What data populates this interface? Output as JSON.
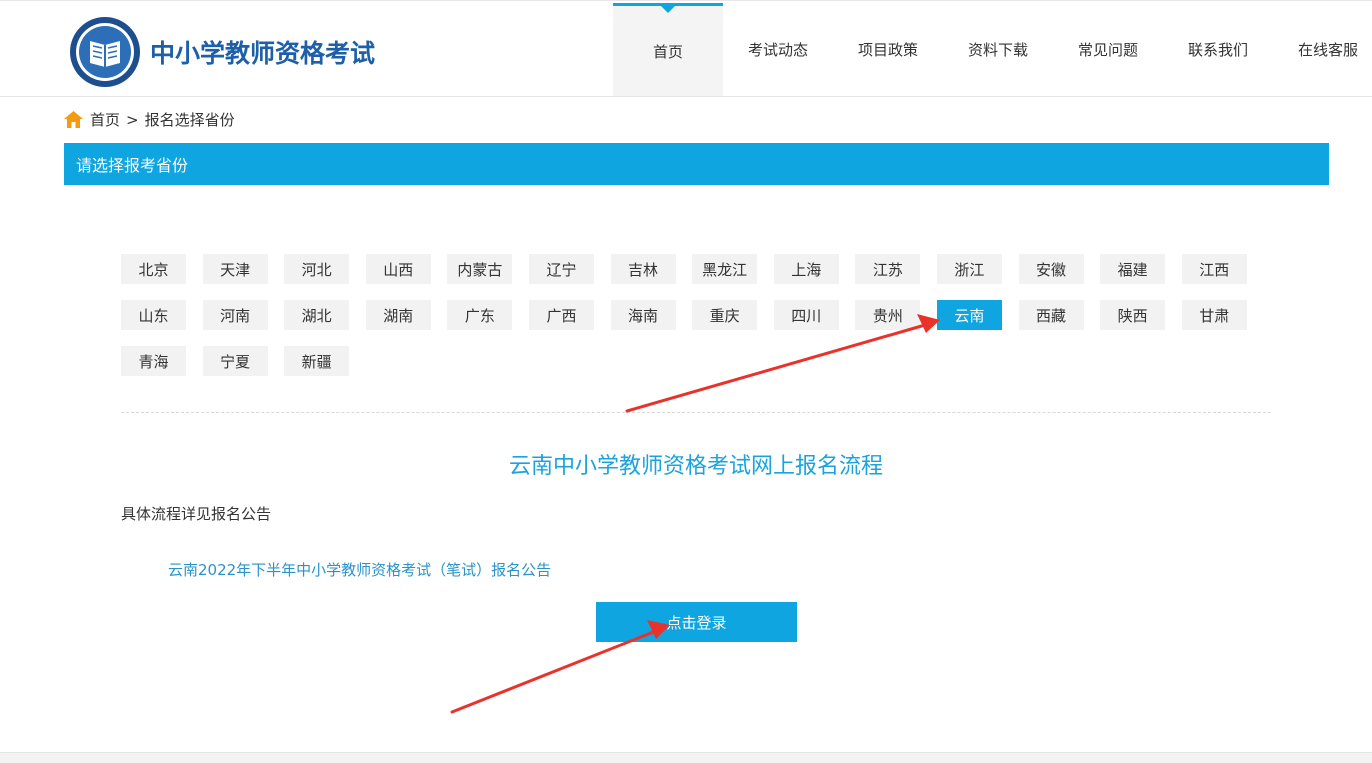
{
  "header": {
    "logo_text": "中小学教师资格考试",
    "logo_icon": "exam-emblem-icon",
    "nav": [
      {
        "label": "首页",
        "active": true
      },
      {
        "label": "考试动态"
      },
      {
        "label": "项目政策"
      },
      {
        "label": "资料下载"
      },
      {
        "label": "常见问题"
      },
      {
        "label": "联系我们"
      },
      {
        "label": "在线客服"
      }
    ]
  },
  "breadcrumb": {
    "icon": "home-icon",
    "home": "首页",
    "separator": ">",
    "current": "报名选择省份"
  },
  "section": {
    "title": "请选择报考省份"
  },
  "provinces": {
    "selected": "云南",
    "items": [
      "北京",
      "天津",
      "河北",
      "山西",
      "内蒙古",
      "辽宁",
      "吉林",
      "黑龙江",
      "上海",
      "江苏",
      "浙江",
      "安徽",
      "福建",
      "江西",
      "山东",
      "河南",
      "湖北",
      "湖南",
      "广东",
      "广西",
      "海南",
      "重庆",
      "四川",
      "贵州",
      "云南",
      "西藏",
      "陕西",
      "甘肃",
      "青海",
      "宁夏",
      "新疆"
    ]
  },
  "flow": {
    "title": "云南中小学教师资格考试网上报名流程",
    "detail": "具体流程详见报名公告",
    "notice_link": "云南2022年下半年中小学教师资格考试（笔试）报名公告",
    "login_button": "点击登录"
  },
  "colors": {
    "accent": "#0ea5e0",
    "logo_text": "#1d5fa8",
    "link": "#2a93c8",
    "annotation_arrow": "#e8322b"
  }
}
